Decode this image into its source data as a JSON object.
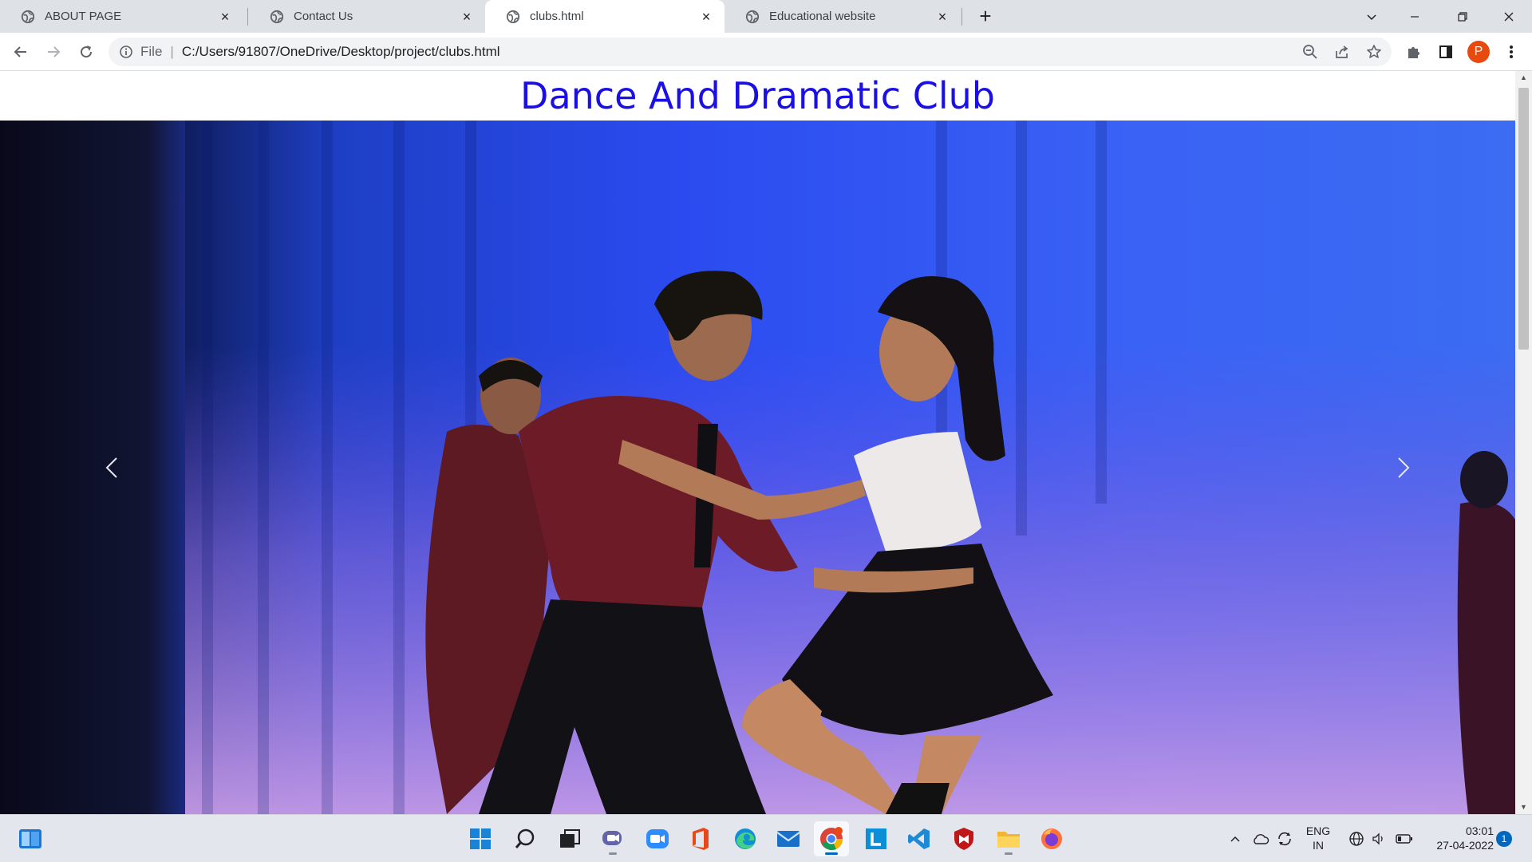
{
  "browser": {
    "tabs": [
      {
        "title": "ABOUT PAGE",
        "active": false
      },
      {
        "title": "Contact Us",
        "active": false
      },
      {
        "title": "clubs.html",
        "active": true
      },
      {
        "title": "Educational website",
        "active": false
      }
    ],
    "omnibox": {
      "scheme_label": "File",
      "separator": "|",
      "url": "C:/Users/91807/OneDrive/Desktop/project/clubs.html"
    },
    "profile_initial": "P"
  },
  "page": {
    "title": "Dance And Dramatic Club",
    "title_color": "#1a10e6",
    "carousel": {
      "prev_icon": "chevron-left-icon",
      "next_icon": "chevron-right-icon",
      "image": "dancers-on-stage-photo"
    }
  },
  "taskbar": {
    "apps": [
      "start",
      "search",
      "task-view",
      "teams",
      "zoom",
      "office",
      "edge",
      "mail",
      "chrome",
      "lockdown",
      "vscode",
      "mcafee",
      "file-explorer",
      "firefox"
    ],
    "active_app": "chrome",
    "language": {
      "line1": "ENG",
      "line2": "IN"
    },
    "clock": {
      "time": "03:01",
      "date": "27-04-2022"
    },
    "notification_count": "1"
  },
  "colors": {
    "accent": "#0067c0",
    "tab_strip": "#dee1e6",
    "profile": "#e8490f"
  }
}
